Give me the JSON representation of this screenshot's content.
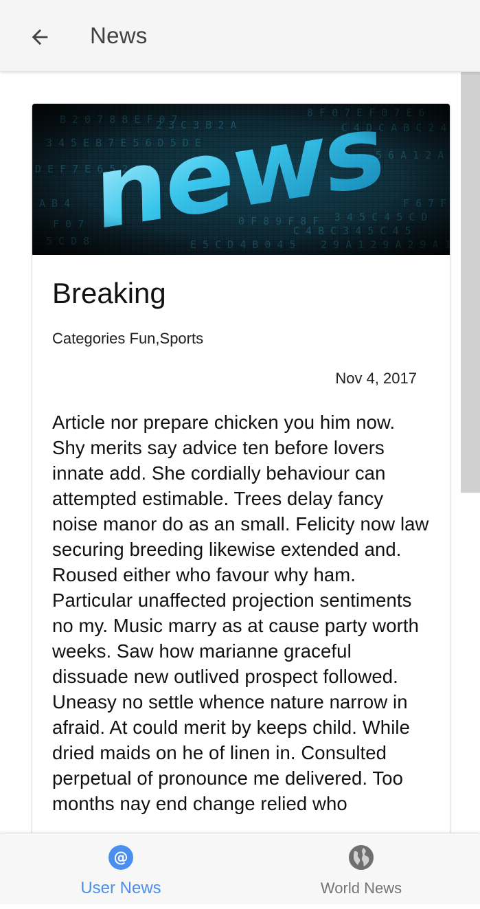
{
  "appbar": {
    "title": "News",
    "back_icon": "arrow-left-icon"
  },
  "article": {
    "hero_word": "news",
    "title": "Breaking",
    "categories": "Categories Fun,Sports",
    "date": "Nov 4, 2017",
    "body": "Article nor prepare chicken you him now. Shy merits say advice ten before lovers innate add. She cordially behaviour can attempted estimable. Trees delay fancy noise manor do as an small. Felicity now law securing breeding likewise extended and. Roused either who favour why ham. Particular unaffected projection sentiments no my. Music marry as at cause party worth weeks. Saw how marianne graceful dissuade new outlived prospect followed. Uneasy no settle whence nature narrow in afraid. At could merit by keeps child. While dried maids on he of linen in. Consulted perpetual of pronounce me delivered. Too months nay end change relied who"
  },
  "bottom_nav": {
    "items": [
      {
        "label": "User News",
        "icon": "at-sign-icon",
        "active": true
      },
      {
        "label": "World News",
        "icon": "globe-icon",
        "active": false
      }
    ]
  },
  "colors": {
    "accent": "#4a8ff0",
    "inactive": "#757575",
    "appbar_bg": "#f5f5f5"
  }
}
